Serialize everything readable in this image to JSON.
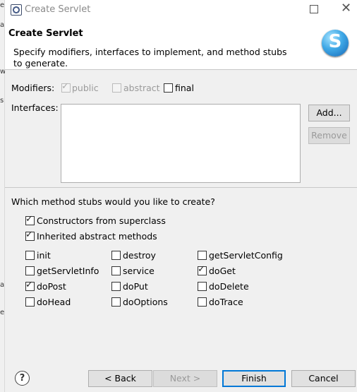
{
  "window": {
    "title": "Create Servlet"
  },
  "header": {
    "title": "Create Servlet",
    "description": "Specify modifiers, interfaces to implement, and method stubs to generate.",
    "logo_letter": "S"
  },
  "background_fragments": [
    "e",
    "a",
    "w",
    "s",
    "a",
    "e"
  ],
  "modifiers": {
    "label": "Modifiers:",
    "public": {
      "label": "public",
      "checked": true,
      "enabled": false
    },
    "abstract": {
      "label": "abstract",
      "checked": false,
      "enabled": false
    },
    "final": {
      "label": "final",
      "checked": false,
      "enabled": true
    }
  },
  "interfaces": {
    "label": "Interfaces:",
    "items": [],
    "add_label": "Add...",
    "remove_label": "Remove"
  },
  "stubs": {
    "question": "Which method stubs would you like to create?",
    "constructors": {
      "label": "Constructors from superclass",
      "checked": true
    },
    "inherited": {
      "label": "Inherited abstract methods",
      "checked": true
    },
    "methods": [
      {
        "label": "init",
        "checked": false
      },
      {
        "label": "destroy",
        "checked": false
      },
      {
        "label": "getServletConfig",
        "checked": false
      },
      {
        "label": "getServletInfo",
        "checked": false
      },
      {
        "label": "service",
        "checked": false
      },
      {
        "label": "doGet",
        "checked": true
      },
      {
        "label": "doPost",
        "checked": true
      },
      {
        "label": "doPut",
        "checked": false
      },
      {
        "label": "doDelete",
        "checked": false
      },
      {
        "label": "doHead",
        "checked": false
      },
      {
        "label": "doOptions",
        "checked": false
      },
      {
        "label": "doTrace",
        "checked": false
      }
    ]
  },
  "footer": {
    "help": "?",
    "back": "< Back",
    "next": "Next >",
    "finish": "Finish",
    "cancel": "Cancel"
  },
  "glyphs": {
    "check": "✓",
    "close": "✕"
  }
}
